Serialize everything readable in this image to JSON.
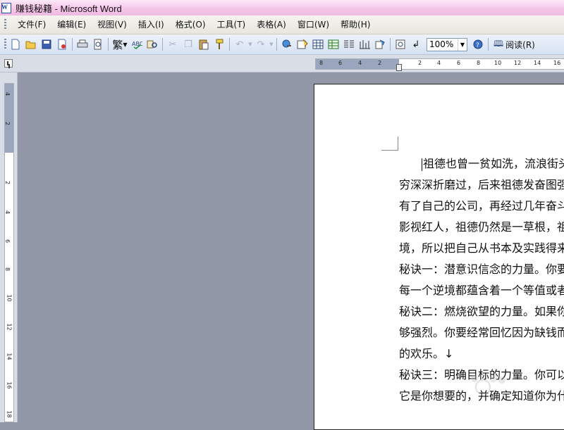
{
  "window": {
    "title": "赚钱秘籍 - Microsoft Word"
  },
  "menu": [
    "文件(F)",
    "编辑(E)",
    "视图(V)",
    "插入(I)",
    "格式(O)",
    "工具(T)",
    "表格(A)",
    "窗口(W)",
    "帮助(H)"
  ],
  "toolbar": {
    "trad_chinese_label": "繁",
    "zoom_value": "100%",
    "read_label": "阅读(R)",
    "icons": [
      "new-icon",
      "open-icon",
      "save-icon",
      "permission-icon",
      "print-icon",
      "print-preview-icon",
      "traditional-chinese-icon",
      "spelling-icon",
      "research-icon",
      "cut-icon",
      "copy-icon",
      "paste-icon",
      "format-painter-icon",
      "undo-icon",
      "redo-icon",
      "hyperlink-icon",
      "tables-borders-icon",
      "insert-table-icon",
      "insert-excel-icon",
      "columns-icon",
      "drawing-icon",
      "document-map-icon",
      "show-hide-icon",
      "help-icon",
      "read-icon"
    ]
  },
  "rulers": {
    "horizontal_ticks": [
      "8",
      "6",
      "4",
      "2",
      "2",
      "4",
      "6",
      "8",
      "10",
      "12",
      "14",
      "16"
    ],
    "vertical_ticks": [
      "4",
      "2",
      "2",
      "4",
      "6",
      "8",
      "10",
      "12",
      "14",
      "16",
      "18"
    ]
  },
  "document": {
    "lines": [
      "祖德也曾一贫如洗，流浪街头",
      "穷深深折磨过，后来祖德发奋图强",
      "有了自己的公司，再经过几年奋斗",
      "影视红人，祖德仍然是一草根，祖",
      "境，所以把自己从书本及实践得来",
      "秘诀一：潜意识信念的力量。你要不",
      "每一个逆境都蕴含着一个等值或者",
      "秘诀二：燃烧欲望的力量。如果你",
      "够强烈。你要经常回忆因为缺钱而",
      "的欢乐。↓",
      "秘诀三：明确目标的力量。你可以",
      "它是你想要的，并确定知道你为什"
    ]
  },
  "colors": {
    "workspace": "#9297a8",
    "titlebar": "#f6c8ea",
    "toolbar": "#d6e1f1"
  }
}
